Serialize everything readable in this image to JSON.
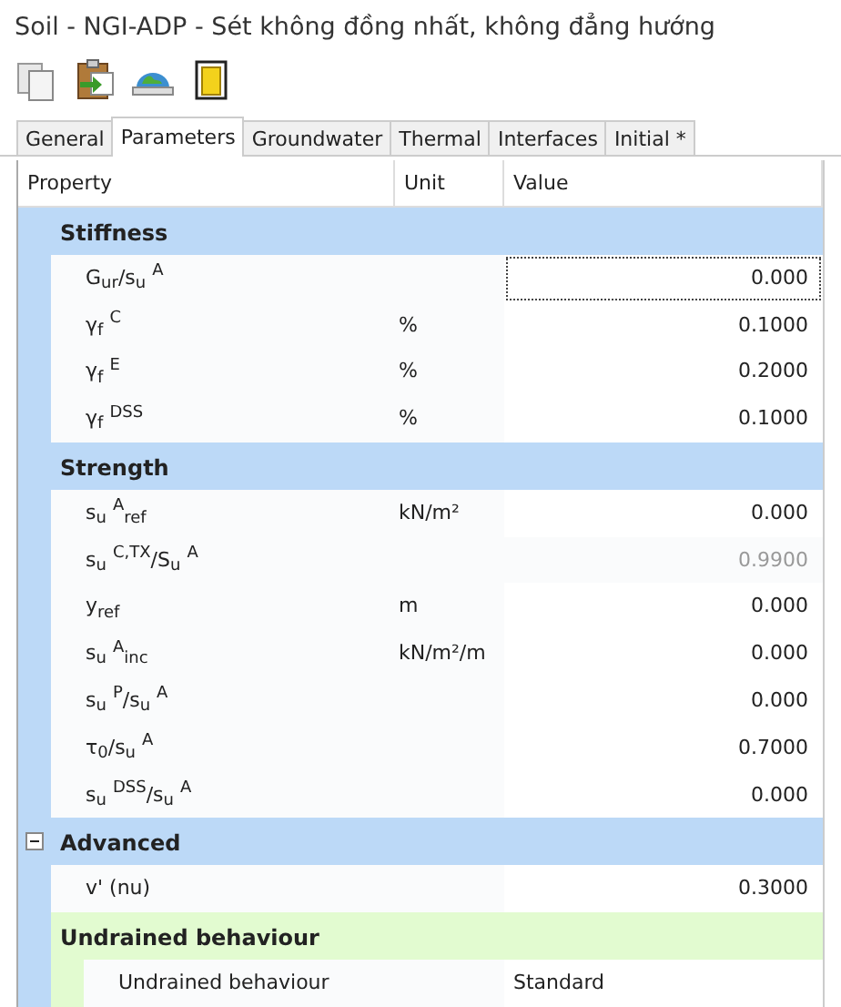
{
  "window": {
    "title": "Soil - NGI-ADP - Sét không đồng nhất, không đẳng hướng"
  },
  "toolbar": [
    {
      "kind": "copy"
    },
    {
      "kind": "paste"
    },
    {
      "kind": "globe"
    },
    {
      "kind": "container"
    }
  ],
  "tabs": [
    {
      "label": "General",
      "selected": false
    },
    {
      "label": "Parameters",
      "selected": true
    },
    {
      "label": "Groundwater",
      "selected": false
    },
    {
      "label": "Thermal",
      "selected": false
    },
    {
      "label": "Interfaces",
      "selected": false
    },
    {
      "label": "Initial *",
      "selected": false
    }
  ],
  "table": {
    "columns": [
      "Property",
      "Unit",
      "Value"
    ],
    "groups": [
      {
        "title": "Stiffness",
        "rows": [
          {
            "property": "G$_{ur}$/s$_{u}$ $^{A}$",
            "value": "0.000",
            "focused": true,
            "disabled": false
          },
          {
            "property": "γ$_{f}$ $^{C}$",
            "unit": "%",
            "value": "0.1000",
            "focused": false,
            "disabled": false
          },
          {
            "property": "γ$_{f}$ $^{E}$",
            "unit": "%",
            "value": "0.2000",
            "focused": false,
            "disabled": false
          },
          {
            "property": "γ$_{f}$ $^{DSS}$",
            "unit": "%",
            "value": "0.1000",
            "focused": false,
            "disabled": false
          }
        ]
      },
      {
        "title": "Strength",
        "rows": [
          {
            "property": "s$_{u}$ $^{A}$$_{ref}$",
            "unit": "kN/m²",
            "value": "0.000",
            "focused": false,
            "disabled": false
          },
          {
            "property": "s$_{u}$ $^{C,TX}$/S$_{u}$ $^{A}$",
            "value": "0.9900",
            "focused": false,
            "disabled": true
          },
          {
            "property": "y$_{ref}$",
            "unit": "m",
            "value": "0.000",
            "focused": false,
            "disabled": false
          },
          {
            "property": "s$_{u}$ $^{A}$$_{inc}$",
            "unit": "kN/m²/m",
            "value": "0.000",
            "focused": false,
            "disabled": false
          },
          {
            "property": "s$_{u}$ $^{P}$/s$_{u}$ $^{A}$",
            "value": "0.000",
            "focused": false,
            "disabled": false
          },
          {
            "property": "τ$_{0}$/s$_{u}$ $^{A}$",
            "value": "0.7000",
            "focused": false,
            "disabled": false
          },
          {
            "property": "s$_{u}$ $^{DSS}$/s$_{u}$ $^{A}$",
            "value": "0.000",
            "focused": false,
            "disabled": false
          }
        ]
      },
      {
        "title": "Advanced",
        "expanded": true,
        "rows": [
          {
            "property": "v' (nu)",
            "value": "0.3000",
            "focused": false,
            "disabled": false
          }
        ],
        "subgroups": [
          {
            "title": "Undrained behaviour",
            "rows": [
              {
                "property": "Undrained behaviour",
                "value": "Standard",
                "kind": "text",
                "focused": false,
                "disabled": false
              }
            ]
          }
        ]
      }
    ]
  }
}
